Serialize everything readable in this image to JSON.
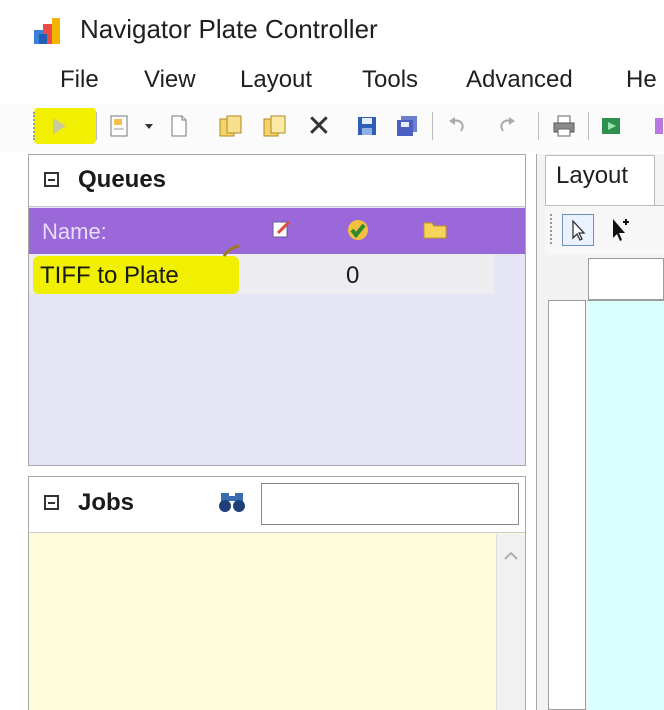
{
  "window": {
    "title": "Navigator Plate Controller",
    "app_icon": "app-logo-icon"
  },
  "menu": [
    "File",
    "View",
    "Layout",
    "Tools",
    "Advanced",
    "He"
  ],
  "toolbar": {
    "icons": [
      "play-icon",
      "new-document-icon",
      "dropdown-arrow-icon",
      "blank-page-icon",
      "copy-pages-icon",
      "duplicate-icon",
      "delete-icon",
      "save-icon",
      "save-all-icon",
      "undo-icon",
      "redo-icon",
      "print-icon",
      "export-icon"
    ],
    "delete_glyph": "✕",
    "highlight_color": "#f0f000"
  },
  "queues": {
    "title": "Queues",
    "columns": {
      "name": "Name:",
      "icons": [
        "edit-icon",
        "check-icon",
        "folder-icon"
      ]
    },
    "rows": [
      {
        "name": "TIFF to Plate",
        "count": "0"
      }
    ],
    "header_color": "#9a68d9",
    "background_color": "#e6e5f6"
  },
  "jobs": {
    "title": "Jobs",
    "search_icon": "binoculars-icon",
    "search_value": "",
    "background_color": "#fffcdc"
  },
  "right_panel": {
    "tab_label": "Layout",
    "tools": [
      "select-arrow-icon",
      "add-pointer-icon"
    ],
    "canvas_color": "#dbffff"
  }
}
